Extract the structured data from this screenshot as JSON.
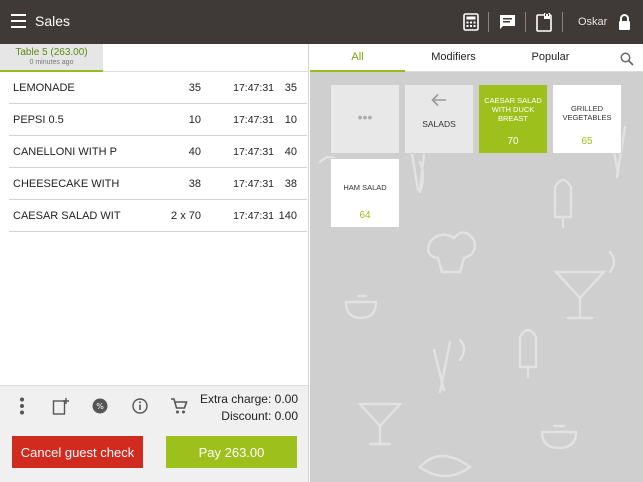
{
  "header": {
    "title": "Sales",
    "user": "Oskar",
    "icons": [
      "menu-icon",
      "calculator-icon",
      "message-icon",
      "clipboard-lock-icon",
      "lock-icon"
    ]
  },
  "table_tab": {
    "label": "Table 5 (263.00)",
    "subtitle": "0 minutes ago"
  },
  "order_items": [
    {
      "name": "LEMONADE",
      "qty": "35",
      "time": "17:47:31",
      "amount": "35"
    },
    {
      "name": "PEPSI 0.5",
      "qty": "10",
      "time": "17:47:31",
      "amount": "10"
    },
    {
      "name": "CANELLONI WITH P",
      "qty": "40",
      "time": "17:47:31",
      "amount": "40"
    },
    {
      "name": "CHEESECAKE WITH",
      "qty": "38",
      "time": "17:47:31",
      "amount": "38"
    },
    {
      "name": "CAESAR SALAD WIT",
      "qty": "2 x 70",
      "time": "17:47:31",
      "amount": "140"
    }
  ],
  "footer": {
    "extra_charge": "Extra charge: 0.00",
    "discount": "Discount: 0.00",
    "cancel_label": "Cancel guest check",
    "pay_label": "Pay 263.00",
    "icons": [
      "more-vertical-icon",
      "add-note-icon",
      "discount-badge-icon",
      "info-icon",
      "cart-icon"
    ]
  },
  "product_tabs": {
    "items": [
      "All",
      "Modifiers",
      "Popular"
    ],
    "active": "All"
  },
  "tiles": [
    {
      "label": "•••",
      "price": "",
      "style": "grey"
    },
    {
      "label": "SALADS",
      "price": "",
      "style": "grey",
      "icon": "back-arrow-icon"
    },
    {
      "label": "CAESAR SALAD WITH DUCK BREAST",
      "price": "70",
      "style": "green"
    },
    {
      "label": "GRILLED VEGETABLES",
      "price": "65",
      "style": "white"
    },
    {
      "label": "HAM SALAD",
      "price": "64",
      "style": "white"
    }
  ],
  "colors": {
    "header_bg": "#3f3a37",
    "accent_green": "#9ec01c",
    "cancel_red": "#d12a1f",
    "panel_grey": "#cfcfcf"
  }
}
